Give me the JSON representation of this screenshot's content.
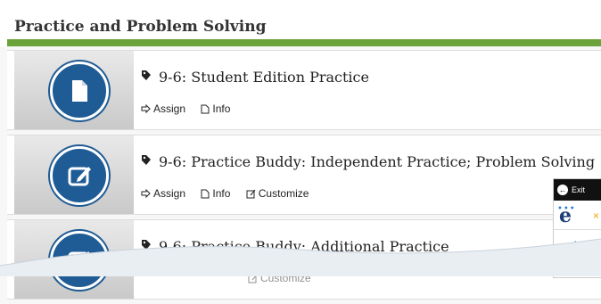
{
  "header": {
    "title": "Practice and Problem Solving"
  },
  "rows": [
    {
      "title": "9-6: Student Edition Practice",
      "icon": "document-icon",
      "actions": {
        "assign": "Assign",
        "info": "Info"
      }
    },
    {
      "title": "9-6: Practice Buddy: Independent Practice; Problem Solving",
      "icon": "edit-icon",
      "actions": {
        "assign": "Assign",
        "info": "Info",
        "customize": "Customize"
      }
    },
    {
      "title": "9-6: Practice Buddy: Additional Practice",
      "icon": "edit-icon",
      "actions": {
        "customize": "Customize"
      }
    }
  ],
  "widget": {
    "exit_label": "Exit",
    "logo": "e"
  },
  "colors": {
    "accent_green": "#6aa33a",
    "circle_blue": "#1f5b94",
    "logo_blue": "#1b3f75"
  }
}
